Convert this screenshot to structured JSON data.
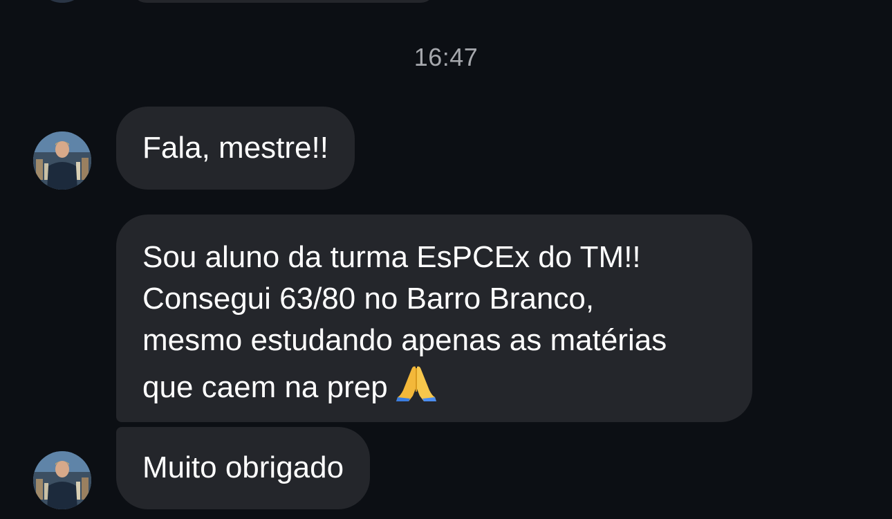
{
  "chat": {
    "timestamp": "16:47",
    "messages": [
      {
        "lines": [
          "Fala, mestre!!"
        ]
      },
      {
        "lines": [
          "Sou aluno da turma EsPCEx do TM!!",
          "Consegui 63/80 no Barro Branco,",
          "mesmo estudando apenas as matérias",
          "que caem na prep"
        ],
        "emoji": "folded-hands"
      },
      {
        "lines": [
          "Muito obrigado"
        ]
      }
    ]
  },
  "colors": {
    "background": "#0c0f14",
    "bubble": "#24262b",
    "timestamp": "#a6a8ad",
    "text": "#ffffff"
  }
}
